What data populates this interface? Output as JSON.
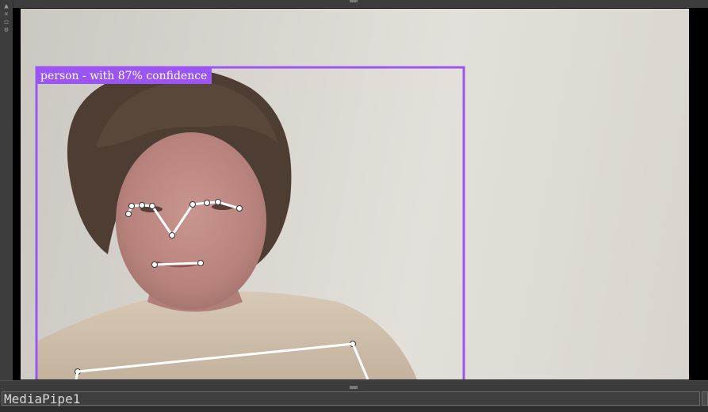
{
  "window": {
    "viewer_name": "MediaPipe1",
    "side_icons": [
      "pin-icon",
      "close-icon",
      "maximize-icon",
      "settings-icon"
    ]
  },
  "detection": {
    "label": "person - with 87% confidence",
    "box_color": "#9b55f0",
    "skeleton_color": "#ffffff"
  },
  "colors": {
    "frame": "#3c3c3c",
    "status_text": "#d8d8d8",
    "letterbox": "#000000"
  }
}
